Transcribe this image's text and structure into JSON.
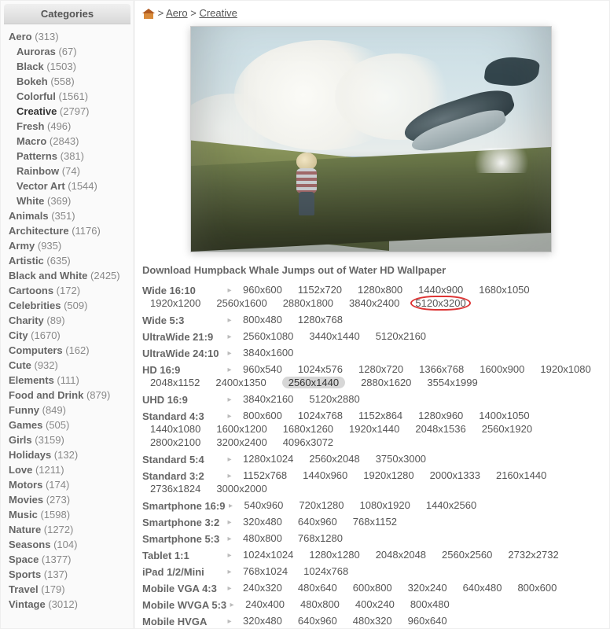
{
  "sidebar": {
    "title": "Categories",
    "items": [
      {
        "name": "Aero",
        "count": 313,
        "sub": false,
        "selected": false
      },
      {
        "name": "Auroras",
        "count": 67,
        "sub": true,
        "selected": false
      },
      {
        "name": "Black",
        "count": 1503,
        "sub": true,
        "selected": false
      },
      {
        "name": "Bokeh",
        "count": 558,
        "sub": true,
        "selected": false
      },
      {
        "name": "Colorful",
        "count": 1561,
        "sub": true,
        "selected": false
      },
      {
        "name": "Creative",
        "count": 2797,
        "sub": true,
        "selected": true
      },
      {
        "name": "Fresh",
        "count": 496,
        "sub": true,
        "selected": false
      },
      {
        "name": "Macro",
        "count": 2843,
        "sub": true,
        "selected": false
      },
      {
        "name": "Patterns",
        "count": 381,
        "sub": true,
        "selected": false
      },
      {
        "name": "Rainbow",
        "count": 74,
        "sub": true,
        "selected": false
      },
      {
        "name": "Vector Art",
        "count": 1544,
        "sub": true,
        "selected": false
      },
      {
        "name": "White",
        "count": 369,
        "sub": true,
        "selected": false
      },
      {
        "name": "Animals",
        "count": 351,
        "sub": false,
        "selected": false
      },
      {
        "name": "Architecture",
        "count": 1176,
        "sub": false,
        "selected": false
      },
      {
        "name": "Army",
        "count": 935,
        "sub": false,
        "selected": false
      },
      {
        "name": "Artistic",
        "count": 635,
        "sub": false,
        "selected": false
      },
      {
        "name": "Black and White",
        "count": 2425,
        "sub": false,
        "selected": false
      },
      {
        "name": "Cartoons",
        "count": 172,
        "sub": false,
        "selected": false
      },
      {
        "name": "Celebrities",
        "count": 509,
        "sub": false,
        "selected": false
      },
      {
        "name": "Charity",
        "count": 89,
        "sub": false,
        "selected": false
      },
      {
        "name": "City",
        "count": 1670,
        "sub": false,
        "selected": false
      },
      {
        "name": "Computers",
        "count": 162,
        "sub": false,
        "selected": false
      },
      {
        "name": "Cute",
        "count": 932,
        "sub": false,
        "selected": false
      },
      {
        "name": "Elements",
        "count": 111,
        "sub": false,
        "selected": false
      },
      {
        "name": "Food and Drink",
        "count": 879,
        "sub": false,
        "selected": false
      },
      {
        "name": "Funny",
        "count": 849,
        "sub": false,
        "selected": false
      },
      {
        "name": "Games",
        "count": 505,
        "sub": false,
        "selected": false
      },
      {
        "name": "Girls",
        "count": 3159,
        "sub": false,
        "selected": false
      },
      {
        "name": "Holidays",
        "count": 132,
        "sub": false,
        "selected": false
      },
      {
        "name": "Love",
        "count": 1211,
        "sub": false,
        "selected": false
      },
      {
        "name": "Motors",
        "count": 174,
        "sub": false,
        "selected": false
      },
      {
        "name": "Movies",
        "count": 273,
        "sub": false,
        "selected": false
      },
      {
        "name": "Music",
        "count": 1598,
        "sub": false,
        "selected": false
      },
      {
        "name": "Nature",
        "count": 1272,
        "sub": false,
        "selected": false
      },
      {
        "name": "Seasons",
        "count": 104,
        "sub": false,
        "selected": false
      },
      {
        "name": "Space",
        "count": 1377,
        "sub": false,
        "selected": false
      },
      {
        "name": "Sports",
        "count": 137,
        "sub": false,
        "selected": false
      },
      {
        "name": "Travel",
        "count": 179,
        "sub": false,
        "selected": false
      },
      {
        "name": "Vintage",
        "count": 3012,
        "sub": false,
        "selected": false
      }
    ]
  },
  "breadcrumb": {
    "sep": ">",
    "items": [
      "Aero",
      "Creative"
    ]
  },
  "download": {
    "title": "Download Humpback Whale Jumps out of Water HD Wallpaper",
    "groups": [
      {
        "label": "Wide 16:10",
        "items": [
          {
            "v": "960x600"
          },
          {
            "v": "1152x720"
          },
          {
            "v": "1280x800"
          },
          {
            "v": "1440x900"
          },
          {
            "v": "1680x1050"
          },
          {
            "v": "1920x1200"
          },
          {
            "v": "2560x1600"
          },
          {
            "v": "2880x1800"
          },
          {
            "v": "3840x2400"
          },
          {
            "v": "5120x3200",
            "circled": true
          }
        ]
      },
      {
        "label": "Wide 5:3",
        "items": [
          {
            "v": "800x480"
          },
          {
            "v": "1280x768"
          }
        ]
      },
      {
        "label": "UltraWide 21:9",
        "items": [
          {
            "v": "2560x1080"
          },
          {
            "v": "3440x1440"
          },
          {
            "v": "5120x2160"
          }
        ]
      },
      {
        "label": "UltraWide 24:10",
        "items": [
          {
            "v": "3840x1600"
          }
        ]
      },
      {
        "label": "HD 16:9",
        "items": [
          {
            "v": "960x540"
          },
          {
            "v": "1024x576"
          },
          {
            "v": "1280x720"
          },
          {
            "v": "1366x768"
          },
          {
            "v": "1600x900"
          },
          {
            "v": "1920x1080"
          },
          {
            "v": "2048x1152"
          },
          {
            "v": "2400x1350"
          },
          {
            "v": "2560x1440",
            "pill": true
          },
          {
            "v": "2880x1620"
          },
          {
            "v": "3554x1999"
          }
        ]
      },
      {
        "label": "UHD 16:9",
        "items": [
          {
            "v": "3840x2160"
          },
          {
            "v": "5120x2880"
          }
        ]
      },
      {
        "label": "Standard 4:3",
        "items": [
          {
            "v": "800x600"
          },
          {
            "v": "1024x768"
          },
          {
            "v": "1152x864"
          },
          {
            "v": "1280x960"
          },
          {
            "v": "1400x1050"
          },
          {
            "v": "1440x1080"
          },
          {
            "v": "1600x1200"
          },
          {
            "v": "1680x1260"
          },
          {
            "v": "1920x1440"
          },
          {
            "v": "2048x1536"
          },
          {
            "v": "2560x1920"
          },
          {
            "v": "2800x2100"
          },
          {
            "v": "3200x2400"
          },
          {
            "v": "4096x3072"
          }
        ]
      },
      {
        "label": "Standard 5:4",
        "items": [
          {
            "v": "1280x1024"
          },
          {
            "v": "2560x2048"
          },
          {
            "v": "3750x3000"
          }
        ]
      },
      {
        "label": "Standard 3:2",
        "items": [
          {
            "v": "1152x768"
          },
          {
            "v": "1440x960"
          },
          {
            "v": "1920x1280"
          },
          {
            "v": "2000x1333"
          },
          {
            "v": "2160x1440"
          },
          {
            "v": "2736x1824"
          },
          {
            "v": "3000x2000"
          }
        ]
      },
      {
        "label": "Smartphone 16:9",
        "items": [
          {
            "v": "540x960"
          },
          {
            "v": "720x1280"
          },
          {
            "v": "1080x1920"
          },
          {
            "v": "1440x2560"
          }
        ]
      },
      {
        "label": "Smartphone 3:2",
        "items": [
          {
            "v": "320x480"
          },
          {
            "v": "640x960"
          },
          {
            "v": "768x1152"
          }
        ]
      },
      {
        "label": "Smartphone 5:3",
        "items": [
          {
            "v": "480x800"
          },
          {
            "v": "768x1280"
          }
        ]
      },
      {
        "label": "Tablet 1:1",
        "items": [
          {
            "v": "1024x1024"
          },
          {
            "v": "1280x1280"
          },
          {
            "v": "2048x2048"
          },
          {
            "v": "2560x2560"
          },
          {
            "v": "2732x2732"
          }
        ]
      },
      {
        "label": "iPad 1/2/Mini",
        "items": [
          {
            "v": "768x1024"
          },
          {
            "v": "1024x768"
          }
        ]
      },
      {
        "label": "Mobile VGA 4:3",
        "items": [
          {
            "v": "240x320"
          },
          {
            "v": "480x640"
          },
          {
            "v": "600x800"
          },
          {
            "v": "320x240"
          },
          {
            "v": "640x480"
          },
          {
            "v": "800x600"
          }
        ]
      },
      {
        "label": "Mobile WVGA 5:3",
        "items": [
          {
            "v": "240x400"
          },
          {
            "v": "480x800"
          },
          {
            "v": "400x240"
          },
          {
            "v": "800x480"
          }
        ]
      },
      {
        "label": "Mobile HVGA",
        "items": [
          {
            "v": "320x480"
          },
          {
            "v": "640x960"
          },
          {
            "v": "480x320"
          },
          {
            "v": "960x640"
          }
        ]
      }
    ]
  },
  "glyphs": {
    "arrow": "▸"
  }
}
